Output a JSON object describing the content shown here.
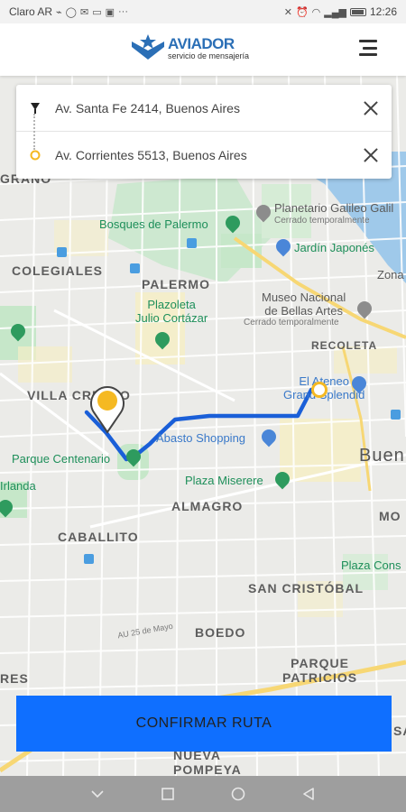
{
  "status_bar": {
    "carrier": "Claro AR",
    "time": "12:26",
    "left_icons": [
      "usb-icon",
      "whatsapp-icon",
      "mail-icon",
      "image-icon",
      "screen-icon",
      "more-icon"
    ],
    "right_icons": [
      "mute-icon",
      "alarm-icon",
      "wifi-icon",
      "signal-icon",
      "battery-icon"
    ]
  },
  "header": {
    "logo_name": "AVIADOR",
    "logo_subtitle": "servicio de mensajería",
    "brand_color": "#2b6fb6"
  },
  "route": {
    "origin": "Av. Santa Fe 2414, Buenos Aires",
    "destination": "Av. Corrientes 5513, Buenos Aires",
    "route_color": "#1a5fd8",
    "destination_color": "#f5b922"
  },
  "map": {
    "labels": {
      "palermo": "PALERMO",
      "colegiales": "COLEGIALES",
      "villa_crespo": "VILLA CRESPO",
      "almagro": "ALMAGRO",
      "caballito": "CABALLITO",
      "san_cristobal": "SAN CRISTÓBAL",
      "boedo": "BOEDO",
      "parque_patricios": "PARQUE\nPATRICIOS",
      "recoleta": "RECOLETA",
      "nueva_pompeya": "NUEVA\nPOMPEYA",
      "grano": "GRANO",
      "res": "RES",
      "buen": "Buen",
      "mo": "MO",
      "sa": "SA"
    },
    "pois": {
      "bosques": "Bosques de Palermo",
      "plazoleta": "Plazoleta\nJulio Cortázar",
      "parque_centenario": "Parque Centenario",
      "abasto": "Abasto Shopping",
      "plaza_miserere": "Plaza Miserere",
      "planetario": "Planetario Galileo Galil",
      "planetario_sub": "Cerrado temporalmente",
      "jardin": "Jardín Japonés",
      "museo": "Museo Nacional\nde Bellas Artes",
      "museo_sub": "Cerrado temporalmente",
      "ateneo": "El Ateneo\nGrand Splendid",
      "plaza_cons": "Plaza Cons",
      "irlanda": "Irlanda",
      "zona": "Zona"
    },
    "streets": {
      "au25": "AU 25 de Mayo"
    }
  },
  "actions": {
    "confirm_label": "CONFIRMAR RUTA",
    "confirm_color": "#0f6fff"
  }
}
